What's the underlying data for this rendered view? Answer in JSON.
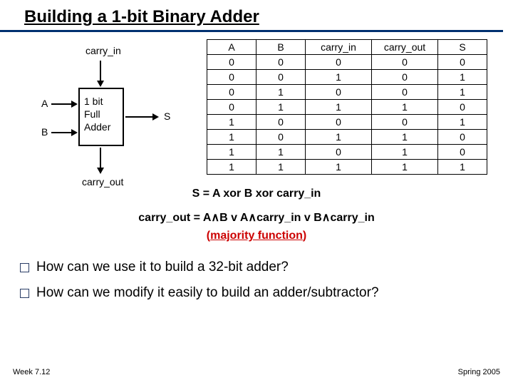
{
  "title": "Building a 1-bit Binary Adder",
  "diagram": {
    "carry_in": "carry_in",
    "carry_out": "carry_out",
    "a": "A",
    "b": "B",
    "s": "S",
    "box_l1": "1 bit",
    "box_l2": "Full",
    "box_l3": "Adder"
  },
  "table": {
    "headers": [
      "A",
      "B",
      "carry_in",
      "carry_out",
      "S"
    ],
    "rows": [
      [
        "0",
        "0",
        "0",
        "0",
        "0"
      ],
      [
        "0",
        "0",
        "1",
        "0",
        "1"
      ],
      [
        "0",
        "1",
        "0",
        "0",
        "1"
      ],
      [
        "0",
        "1",
        "1",
        "1",
        "0"
      ],
      [
        "1",
        "0",
        "0",
        "0",
        "1"
      ],
      [
        "1",
        "0",
        "1",
        "1",
        "0"
      ],
      [
        "1",
        "1",
        "0",
        "1",
        "0"
      ],
      [
        "1",
        "1",
        "1",
        "1",
        "1"
      ]
    ]
  },
  "eq": {
    "s": "S = A  xor  B  xor  carry_in",
    "cout_pre": "carry_out  = A",
    "and1": "∧",
    "b_v_a": "B  v  A",
    "cin_v_b": "carry_in  v  B",
    "cin_tail": "carry_in",
    "par_open": "(",
    "mf": "majority function",
    "par_close": ")"
  },
  "bullets": {
    "q1": "How can we use it to build a 32-bit adder?",
    "q2": "How can we modify it easily to build an adder/subtractor?"
  },
  "footer": {
    "left": "Week 7.12",
    "right": "Spring 2005"
  },
  "chart_data": {
    "type": "table",
    "title": "1-bit Full Adder Truth Table",
    "columns": [
      "A",
      "B",
      "carry_in",
      "carry_out",
      "S"
    ],
    "rows": [
      [
        0,
        0,
        0,
        0,
        0
      ],
      [
        0,
        0,
        1,
        0,
        1
      ],
      [
        0,
        1,
        0,
        0,
        1
      ],
      [
        0,
        1,
        1,
        1,
        0
      ],
      [
        1,
        0,
        0,
        0,
        1
      ],
      [
        1,
        0,
        1,
        1,
        0
      ],
      [
        1,
        1,
        0,
        1,
        0
      ],
      [
        1,
        1,
        1,
        1,
        1
      ]
    ]
  }
}
